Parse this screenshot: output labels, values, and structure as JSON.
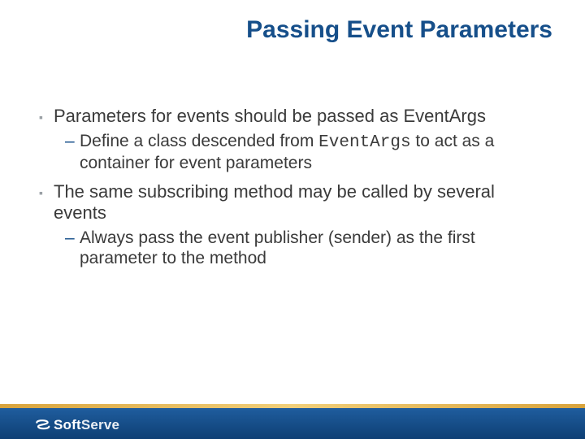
{
  "title": "Passing Event Parameters",
  "bullets": [
    {
      "text": "Parameters for events should be passed as EventArgs",
      "sub": [
        {
          "pre": "Define a class descended from ",
          "code": "EventArgs",
          "post": " to act as a container for event parameters"
        }
      ]
    },
    {
      "text": "The same subscribing method may be called by several events",
      "sub": [
        {
          "pre": "Always pass the event publisher (sender) as the first parameter to the method",
          "code": "",
          "post": ""
        }
      ]
    }
  ],
  "footer": {
    "brand_bold": "Soft",
    "brand_light": "Serve"
  }
}
